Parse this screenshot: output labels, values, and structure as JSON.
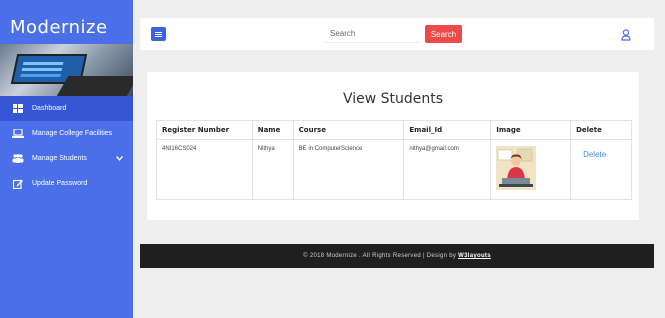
{
  "sidebar": {
    "logo": "Modernize",
    "items": [
      {
        "label": "Dashboard",
        "icon": "dashboard-icon"
      },
      {
        "label": "Manage College Facilities",
        "icon": "laptop-icon"
      },
      {
        "label": "Manage Students",
        "icon": "users-icon"
      },
      {
        "label": "Update Password",
        "icon": "edit-icon"
      }
    ]
  },
  "topbar": {
    "search_placeholder": "Search",
    "search_button": "Search"
  },
  "main": {
    "title": "View Students",
    "table": {
      "headers": [
        "Register Number",
        "Name",
        "Course",
        "Email_Id",
        "Image",
        "Delete"
      ],
      "rows": [
        {
          "register_number": "4NI16CS024",
          "name": "Nithya",
          "course": "BE in ComputerScience",
          "email": "nithya@gmail.com",
          "delete_label": "Delete"
        }
      ]
    }
  },
  "footer": {
    "text": "© 2018 Modernize . All Rights Reserved | Design by ",
    "link": "W3layouts"
  },
  "colors": {
    "sidebar": "#4b6fe8",
    "search_button": "#ef4a4a",
    "footer": "#1f1f1f",
    "link": "#3f8bd6"
  }
}
